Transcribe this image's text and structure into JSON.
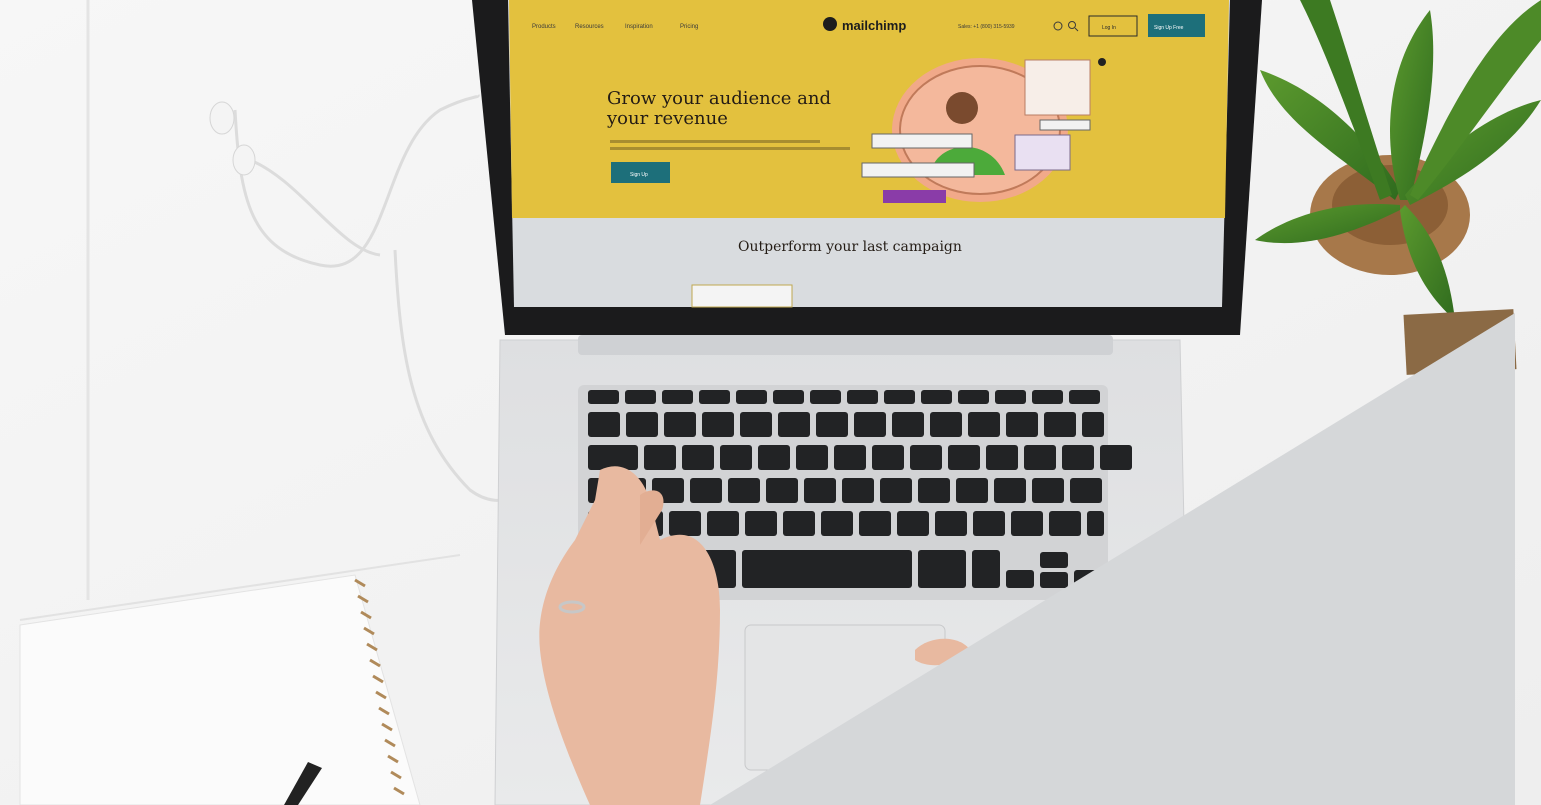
{
  "screen": {
    "nav_items": [
      "Products",
      "Resources",
      "Inspiration",
      "Pricing"
    ],
    "logo_text": "mailchimp",
    "sales_text": "Sales: +1 (800) 315-5939",
    "login_label": "Log In",
    "signup_label": "Sign Up Free",
    "hero_title_line1": "Grow your audience and",
    "hero_title_line2": "your revenue",
    "hero_cta_label": "Sign Up",
    "section_title": "Outperform your last campaign"
  },
  "colors": {
    "hero_bg": "#e3c13e",
    "section_bg": "#d9dcdf",
    "accent_teal": "#1d6f7a",
    "triangle_gray": "#d5d7d9"
  },
  "icons": [
    "search-icon",
    "help-icon",
    "logo-icon"
  ]
}
